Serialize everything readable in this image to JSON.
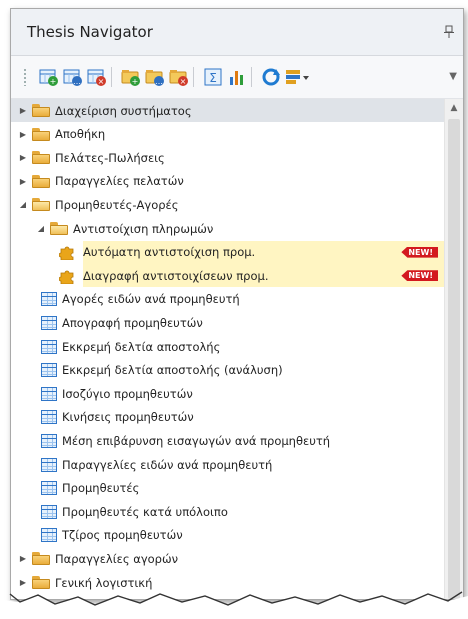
{
  "panel": {
    "title": "Thesis Navigator"
  },
  "toolbar": {
    "buttons": [
      {
        "icon": "add-table-icon",
        "color": "#2e9d3a"
      },
      {
        "icon": "edit-table-icon",
        "color": "#2f6fc0"
      },
      {
        "icon": "delete-table-icon",
        "color": "#d03b2a"
      },
      {
        "icon": "add-folder-icon",
        "color": "#2e9d3a"
      },
      {
        "icon": "edit-folder-icon",
        "color": "#2f6fc0"
      },
      {
        "icon": "delete-folder-icon",
        "color": "#d03b2a"
      },
      {
        "icon": "sum-report-icon",
        "color": "#2f6fc0"
      },
      {
        "icon": "bar-chart-icon",
        "color": "#e07a10"
      },
      {
        "icon": "refresh-icon",
        "color": "#1f7bd1"
      },
      {
        "icon": "dropdown-filter-icon",
        "color": "#e0a020"
      }
    ]
  },
  "tree": {
    "items": [
      {
        "label": "Διαχείριση συστήματος",
        "level": 0,
        "kind": "folder",
        "expanded": false,
        "selected": true
      },
      {
        "label": "Αποθήκη",
        "level": 0,
        "kind": "folder",
        "expanded": false
      },
      {
        "label": "Πελάτες-Πωλήσεις",
        "level": 0,
        "kind": "folder",
        "expanded": false
      },
      {
        "label": "Παραγγελίες πελατών",
        "level": 0,
        "kind": "folder",
        "expanded": false
      },
      {
        "label": "Προμηθευτές-Αγορές",
        "level": 0,
        "kind": "folder",
        "expanded": true
      },
      {
        "label": "Αντιστοίχιση πληρωμών",
        "level": 1,
        "kind": "folder",
        "expanded": true
      },
      {
        "label": "Αυτόματη αντιστοίχιση προμ.",
        "level": 2,
        "kind": "action",
        "badge": "NEW!"
      },
      {
        "label": "Διαγραφή αντιστοιχίσεων προμ.",
        "level": 2,
        "kind": "action",
        "badge": "NEW!"
      },
      {
        "label": "Αγορές ειδών ανά προμηθευτή",
        "level": 1,
        "kind": "report"
      },
      {
        "label": "Απογραφή προμηθευτών",
        "level": 1,
        "kind": "report"
      },
      {
        "label": "Εκκρεμή δελτία αποστολής",
        "level": 1,
        "kind": "report"
      },
      {
        "label": "Εκκρεμή δελτία αποστολής (ανάλυση)",
        "level": 1,
        "kind": "report"
      },
      {
        "label": "Ισοζύγιο προμηθευτών",
        "level": 1,
        "kind": "report"
      },
      {
        "label": "Κινήσεις προμηθευτών",
        "level": 1,
        "kind": "report"
      },
      {
        "label": "Μέση επιβάρυνση εισαγωγών ανά προμηθευτή",
        "level": 1,
        "kind": "report"
      },
      {
        "label": "Παραγγελίες ειδών ανά προμηθευτή",
        "level": 1,
        "kind": "report"
      },
      {
        "label": "Προμηθευτές",
        "level": 1,
        "kind": "report"
      },
      {
        "label": "Προμηθευτές κατά υπόλοιπο",
        "level": 1,
        "kind": "report"
      },
      {
        "label": "Τζίρος προμηθευτών",
        "level": 1,
        "kind": "report"
      },
      {
        "label": "Παραγγελίες αγορών",
        "level": 0,
        "kind": "folder",
        "expanded": false
      },
      {
        "label": "Γενική λογιστική",
        "level": 0,
        "kind": "folder",
        "expanded": false
      }
    ]
  },
  "colors": {
    "badge": "#d3191f",
    "highlight": "#fff5c2",
    "selected": "#dfe3e8",
    "accent_blue": "#2f75c7"
  }
}
